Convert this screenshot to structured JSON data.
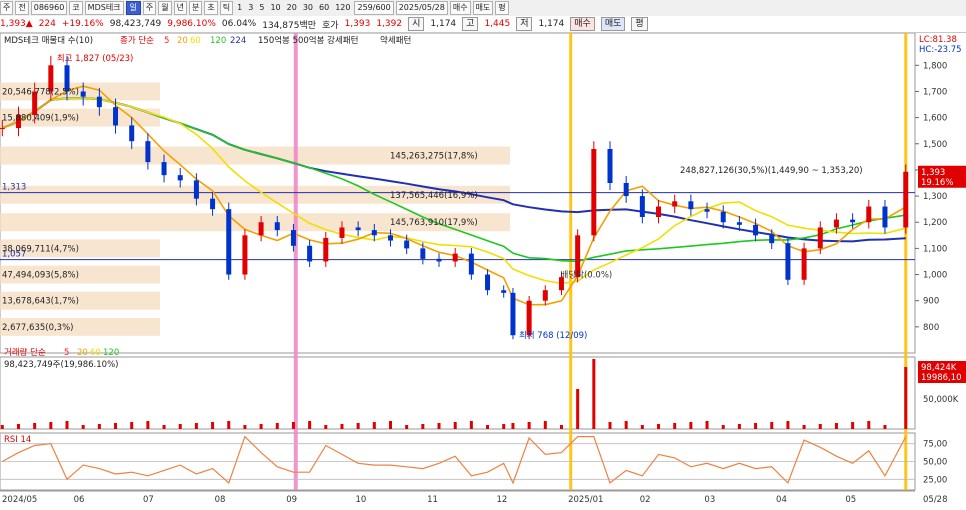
{
  "toolbar": {
    "items": [
      {
        "label": "주"
      },
      {
        "label": "전"
      },
      {
        "label": "086960"
      },
      {
        "label": "코"
      },
      {
        "label": "MDS테크"
      },
      {
        "label": "일"
      },
      {
        "label": "주"
      },
      {
        "label": "월"
      },
      {
        "label": "년"
      },
      {
        "label": "분"
      },
      {
        "label": "초"
      },
      {
        "label": "틱"
      },
      {
        "label": "1"
      },
      {
        "label": "3"
      },
      {
        "label": "5"
      },
      {
        "label": "10"
      },
      {
        "label": "20"
      },
      {
        "label": "30"
      },
      {
        "label": "60"
      },
      {
        "label": "120"
      },
      {
        "label": "259/600"
      },
      {
        "label": "2025/05/28"
      },
      {
        "label": "매수"
      },
      {
        "label": "매도"
      },
      {
        "label": "평"
      }
    ]
  },
  "quote": {
    "price": "1,393▲",
    "change": "224",
    "change_pct": "+19.16%",
    "volume": "98,423,749",
    "vol_ratio": "9,986.10%",
    "turnover": "06.04%",
    "amount": "134,875백만",
    "ask_label": "호가",
    "ask": "1,393",
    "bid": "1,392",
    "low_label": "시",
    "open": "1,174",
    "high_label": "고",
    "high": "1,445",
    "close_label": "저",
    "low": "1,174",
    "buy": "매수",
    "sell": "매도",
    "avg": "평"
  },
  "legend": {
    "main": "MDS테크 매물대 수(10)",
    "ma_label": "종가 단순",
    "ma_periods": [
      "5",
      "20",
      "60",
      "120",
      "224"
    ],
    "pattern1": "150억봉 500억봉 강세패턴",
    "pattern2": "약세패턴",
    "volume": "거래량 단순",
    "vol_periods": [
      "5",
      "20",
      "60",
      "120"
    ],
    "volume_value": "98,423,749주(19,986.10%)",
    "rsi": "RSI 14",
    "lc": "LC:81.38",
    "hc": "HC:-23.75"
  },
  "colors": {
    "up": "#e00000",
    "down": "#0033cc",
    "ma5": "#ff2020",
    "ma20": "#f5a000",
    "ma60": "#f0e000",
    "ma120": "#1ec81e",
    "ma224": "#2030b0",
    "highlight": "#ffc000",
    "pink": "#f08ac8",
    "rsi": "#f08040",
    "box": "#f5dcc0"
  },
  "chart_data": {
    "type": "candlestick",
    "y_ticks": [
      "1,800",
      "1,700",
      "1,600",
      "1,500",
      "1,400",
      "1,300",
      "1,200",
      "1,100",
      "1,000",
      "900",
      "800"
    ],
    "ylim": [
      700,
      1870
    ],
    "x_labels": [
      "2024/05",
      "06",
      "07",
      "08",
      "09",
      "10",
      "11",
      "12",
      "2025/01",
      "02",
      "03",
      "04",
      "05",
      "05/28"
    ],
    "last_price": "1,393",
    "last_change": "19.16%",
    "h_levels": [
      {
        "label": "1,313",
        "value": 1313
      },
      {
        "label": "1,057",
        "value": 1057
      }
    ],
    "price_series": [
      [
        "2024-05-02",
        1560
      ],
      [
        "2024-05-09",
        1610
      ],
      [
        "2024-05-16",
        1700
      ],
      [
        "2024-05-23",
        1800
      ],
      [
        "2024-05-30",
        1700
      ],
      [
        "2024-06-06",
        1680
      ],
      [
        "2024-06-13",
        1640
      ],
      [
        "2024-06-20",
        1570
      ],
      [
        "2024-06-27",
        1510
      ],
      [
        "2024-07-04",
        1430
      ],
      [
        "2024-07-11",
        1380
      ],
      [
        "2024-07-18",
        1360
      ],
      [
        "2024-07-25",
        1290
      ],
      [
        "2024-08-01",
        1250
      ],
      [
        "2024-08-08",
        1000
      ],
      [
        "2024-08-15",
        1150
      ],
      [
        "2024-08-22",
        1200
      ],
      [
        "2024-08-29",
        1170
      ],
      [
        "2024-09-05",
        1110
      ],
      [
        "2024-09-12",
        1050
      ],
      [
        "2024-09-19",
        1140
      ],
      [
        "2024-09-26",
        1180
      ],
      [
        "2024-10-03",
        1170
      ],
      [
        "2024-10-10",
        1150
      ],
      [
        "2024-10-17",
        1130
      ],
      [
        "2024-10-24",
        1100
      ],
      [
        "2024-10-31",
        1060
      ],
      [
        "2024-11-07",
        1050
      ],
      [
        "2024-11-14",
        1080
      ],
      [
        "2024-11-21",
        1000
      ],
      [
        "2024-11-28",
        940
      ],
      [
        "2024-12-05",
        930
      ],
      [
        "2024-12-09",
        768
      ],
      [
        "2024-12-16",
        900
      ],
      [
        "2024-12-23",
        940
      ],
      [
        "2024-12-30",
        990
      ],
      [
        "2025-01-06",
        1150
      ],
      [
        "2025-01-13",
        1480
      ],
      [
        "2025-01-20",
        1350
      ],
      [
        "2025-01-27",
        1300
      ],
      [
        "2025-02-03",
        1220
      ],
      [
        "2025-02-10",
        1260
      ],
      [
        "2025-02-17",
        1280
      ],
      [
        "2025-02-24",
        1250
      ],
      [
        "2025-03-03",
        1240
      ],
      [
        "2025-03-10",
        1200
      ],
      [
        "2025-03-17",
        1190
      ],
      [
        "2025-03-24",
        1150
      ],
      [
        "2025-03-31",
        1120
      ],
      [
        "2025-04-07",
        980
      ],
      [
        "2025-04-14",
        1100
      ],
      [
        "2025-04-21",
        1180
      ],
      [
        "2025-04-28",
        1210
      ],
      [
        "2025-05-05",
        1200
      ],
      [
        "2025-05-12",
        1260
      ],
      [
        "2025-05-19",
        1180
      ],
      [
        "2025-05-28",
        1393
      ]
    ],
    "annotations": [
      {
        "text": "최고 1,827 (05/23)",
        "value": 1827,
        "date": "2024-05-23",
        "color": "#e00000"
      },
      {
        "text": "최저 768 (12/09)",
        "value": 768,
        "date": "2024-12-09",
        "color": "#0033cc"
      },
      {
        "text": "배당락(0.0%)",
        "value": 1000,
        "date": "2024-12-27",
        "color": "#333333"
      }
    ],
    "volume_profile": [
      {
        "label": "20,546,778(2,5%)",
        "value": 1700
      },
      {
        "label": "15,880,409(1,9%)",
        "value": 1600
      },
      {
        "label": "145,263,275(17,8%)",
        "value": 1455
      },
      {
        "label": "248,827,126(30,5%)(1,449,90 ~ 1,353,20)",
        "value": 1400
      },
      {
        "label": "137,565,446(16,9%)",
        "value": 1305
      },
      {
        "label": "145,763,910(17,9%)",
        "value": 1200
      },
      {
        "label": "38,069,711(4,7%)",
        "value": 1100
      },
      {
        "label": "47,494,093(5,8%)",
        "value": 1000
      },
      {
        "label": "13,678,643(1,7%)",
        "value": 900
      },
      {
        "label": "2,677,635(0,3%)",
        "value": 800
      }
    ],
    "volume": {
      "last_label": "98,424K",
      "last_pct": "19986,10",
      "tick": "50,000K"
    },
    "rsi": {
      "ticks": [
        "75,00",
        "50,00",
        "25,00"
      ],
      "upper": 75,
      "lower": 25
    }
  }
}
